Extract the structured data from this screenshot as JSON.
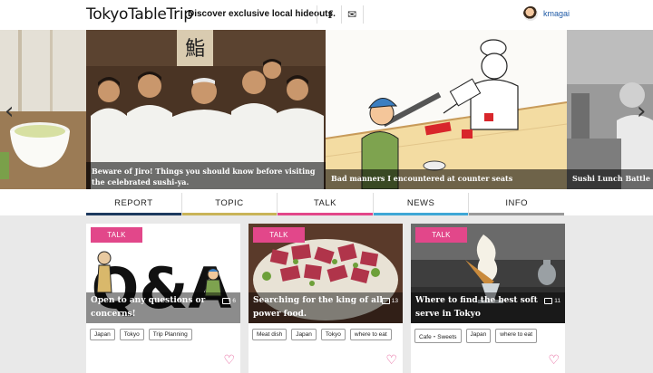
{
  "header": {
    "logo": "TokyoTableTrip",
    "tagline": "Discover exclusive local hideouts.",
    "facebook_glyph": "f",
    "mail_glyph": "✉",
    "username": "kmagai"
  },
  "carousel": {
    "prev_arrow": "‹",
    "next_arrow": "›",
    "slides": [
      {
        "caption": ""
      },
      {
        "caption": "Beware of Jiro! Things you should know before visiting the celebrated sushi-ya."
      },
      {
        "caption": "Bad manners I encountered at counter seats"
      },
      {
        "caption": "Sushi Lunch Battle Roy"
      }
    ]
  },
  "tabs": [
    {
      "label": "REPORT",
      "color": "#1e3a5f"
    },
    {
      "label": "TOPIC",
      "color": "#c9b458"
    },
    {
      "label": "TALK",
      "color": "#e2478a"
    },
    {
      "label": "NEWS",
      "color": "#3fa7d6"
    },
    {
      "label": "INFO",
      "color": "#9a9a9a"
    }
  ],
  "cards": [
    {
      "badge": "TALK",
      "title": "Open to any questions or concerns!",
      "comments": "6",
      "tags": [
        "Japan",
        "Tokyo",
        "Trip Planning"
      ],
      "heart": "♡"
    },
    {
      "badge": "TALK",
      "title": "Searching for the king of all power food.",
      "comments": "13",
      "tags": [
        "Meat dish",
        "Japan",
        "Tokyo",
        "where to eat"
      ],
      "heart": "♡"
    },
    {
      "badge": "TALK",
      "title": "Where to find the best soft serve in Tokyo",
      "comments": "11",
      "tags": [
        "Cafe・Sweets",
        "Japan",
        "where to eat"
      ],
      "heart": "♡"
    }
  ],
  "card1_image_text": "Q&A",
  "accent_color": "#e2478a"
}
